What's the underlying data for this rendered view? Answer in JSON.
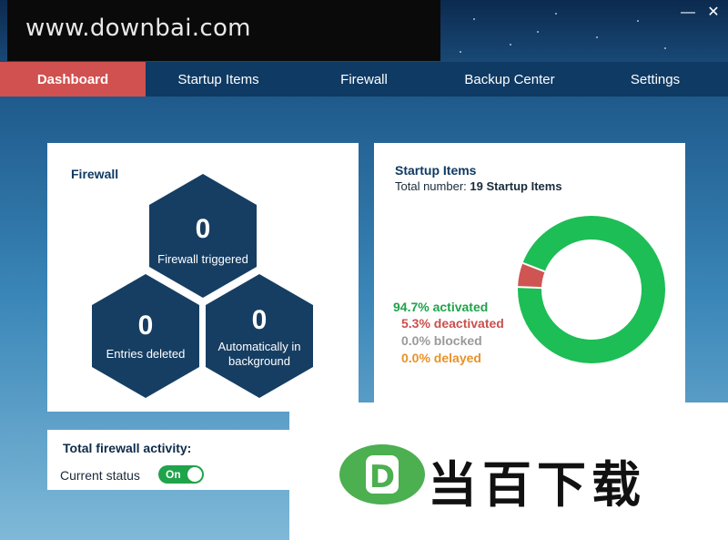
{
  "watermark": {
    "text": "www.downbai.com"
  },
  "window": {
    "minimize": "—",
    "close": "✕"
  },
  "nav": {
    "tabs": [
      {
        "label": "Dashboard",
        "active": true
      },
      {
        "label": "Startup Items",
        "active": false
      },
      {
        "label": "Firewall",
        "active": false
      },
      {
        "label": "Backup Center",
        "active": false
      },
      {
        "label": "Settings",
        "active": false
      }
    ]
  },
  "firewall": {
    "title": "Firewall",
    "triggered": {
      "value": "0",
      "label": "Firewall triggered"
    },
    "deleted": {
      "value": "0",
      "label": "Entries deleted"
    },
    "automatic": {
      "value": "0",
      "label": "Automatically in background"
    }
  },
  "startup": {
    "title": "Startup Items",
    "total_label": "Total number:",
    "total_value": "19",
    "total_unit": "Startup Items",
    "legend": [
      {
        "text": "94.7% activated",
        "color": "#1fa34b",
        "percent": 94.7
      },
      {
        "text": "5.3% deactivated",
        "color": "#c9504d",
        "percent": 5.3
      },
      {
        "text": "0.0% blocked",
        "color": "#9a9a9a",
        "percent": 0.0
      },
      {
        "text": "0.0% delayed",
        "color": "#e8922a",
        "percent": 0.0
      }
    ],
    "donut_colors": {
      "activated": "#1cbe55",
      "deactivated": "#cf5552"
    }
  },
  "activity": {
    "title": "Total firewall activity:",
    "status_label": "Current status",
    "toggle_label": "On"
  },
  "brand": {
    "logo_letter": "D",
    "text": "当百下载",
    "logo_color": "#4caf50"
  },
  "colors": {
    "accent": "#d0514f",
    "navy": "#0f3a63",
    "hex": "#163e63"
  }
}
